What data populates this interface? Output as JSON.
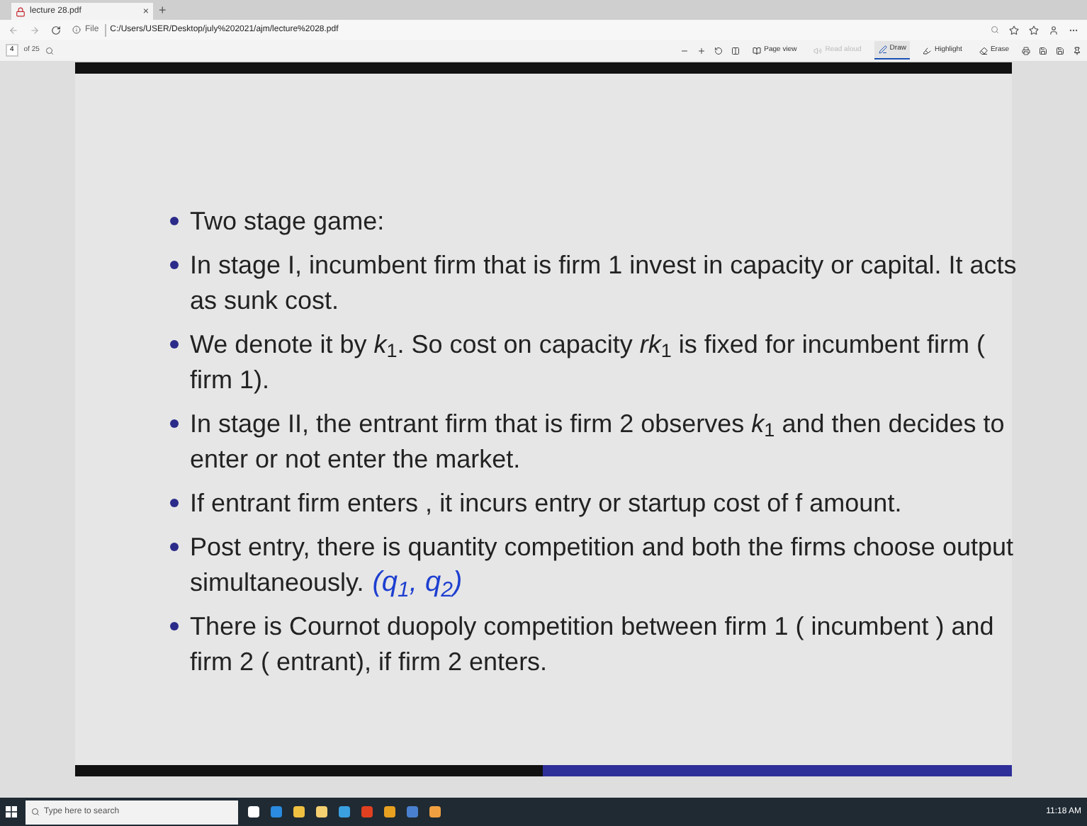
{
  "tab": {
    "title": "lecture 28.pdf",
    "close": "×",
    "new_tab": "+"
  },
  "address": {
    "scheme": "File",
    "url": "C:/Users/USER/Desktop/july%202021/ajm/lecture%2028.pdf"
  },
  "pdf_toolbar": {
    "page": "4",
    "page_count": "of 25",
    "tools": [
      {
        "label": "Page view",
        "selected": false,
        "disabled": false
      },
      {
        "label": "Read aloud",
        "selected": false,
        "disabled": true
      },
      {
        "label": "Draw",
        "selected": true,
        "disabled": false
      },
      {
        "label": "Highlight",
        "selected": false,
        "disabled": false
      },
      {
        "label": "Erase",
        "selected": false,
        "disabled": false
      }
    ]
  },
  "slide": {
    "bullets": [
      {
        "lines": [
          "Two stage game:"
        ]
      },
      {
        "lines": [
          "In stage I, incumbent firm that is firm 1 invest in capacity or capital. It acts",
          "as sunk cost."
        ]
      },
      {
        "lines": [
          "We denote it by *k*$_{1}$. So cost on capacity *rk*$_{1}$ is fixed for incumbent firm (",
          "firm 1)."
        ]
      },
      {
        "lines": [
          "In stage II, the entrant firm that is firm 2 observes *k*$_{1}$ and then decides to",
          "enter or not enter the market."
        ]
      },
      {
        "lines": [
          "If entrant firm enters , it incurs entry or startup cost of f amount."
        ]
      },
      {
        "lines": [
          "Post entry, there is quantity competition and both the firms choose output",
          "simultaneously."
        ],
        "note": "(q$_{1}$, q$_{2}$)"
      },
      {
        "lines": [
          "There is Cournot duopoly competition between firm 1 ( incumbent ) and",
          "firm 2 ( entrant), if firm 2 enters."
        ]
      }
    ]
  },
  "taskbar": {
    "search_placeholder": "Type here to search",
    "time": "11:18 AM"
  }
}
